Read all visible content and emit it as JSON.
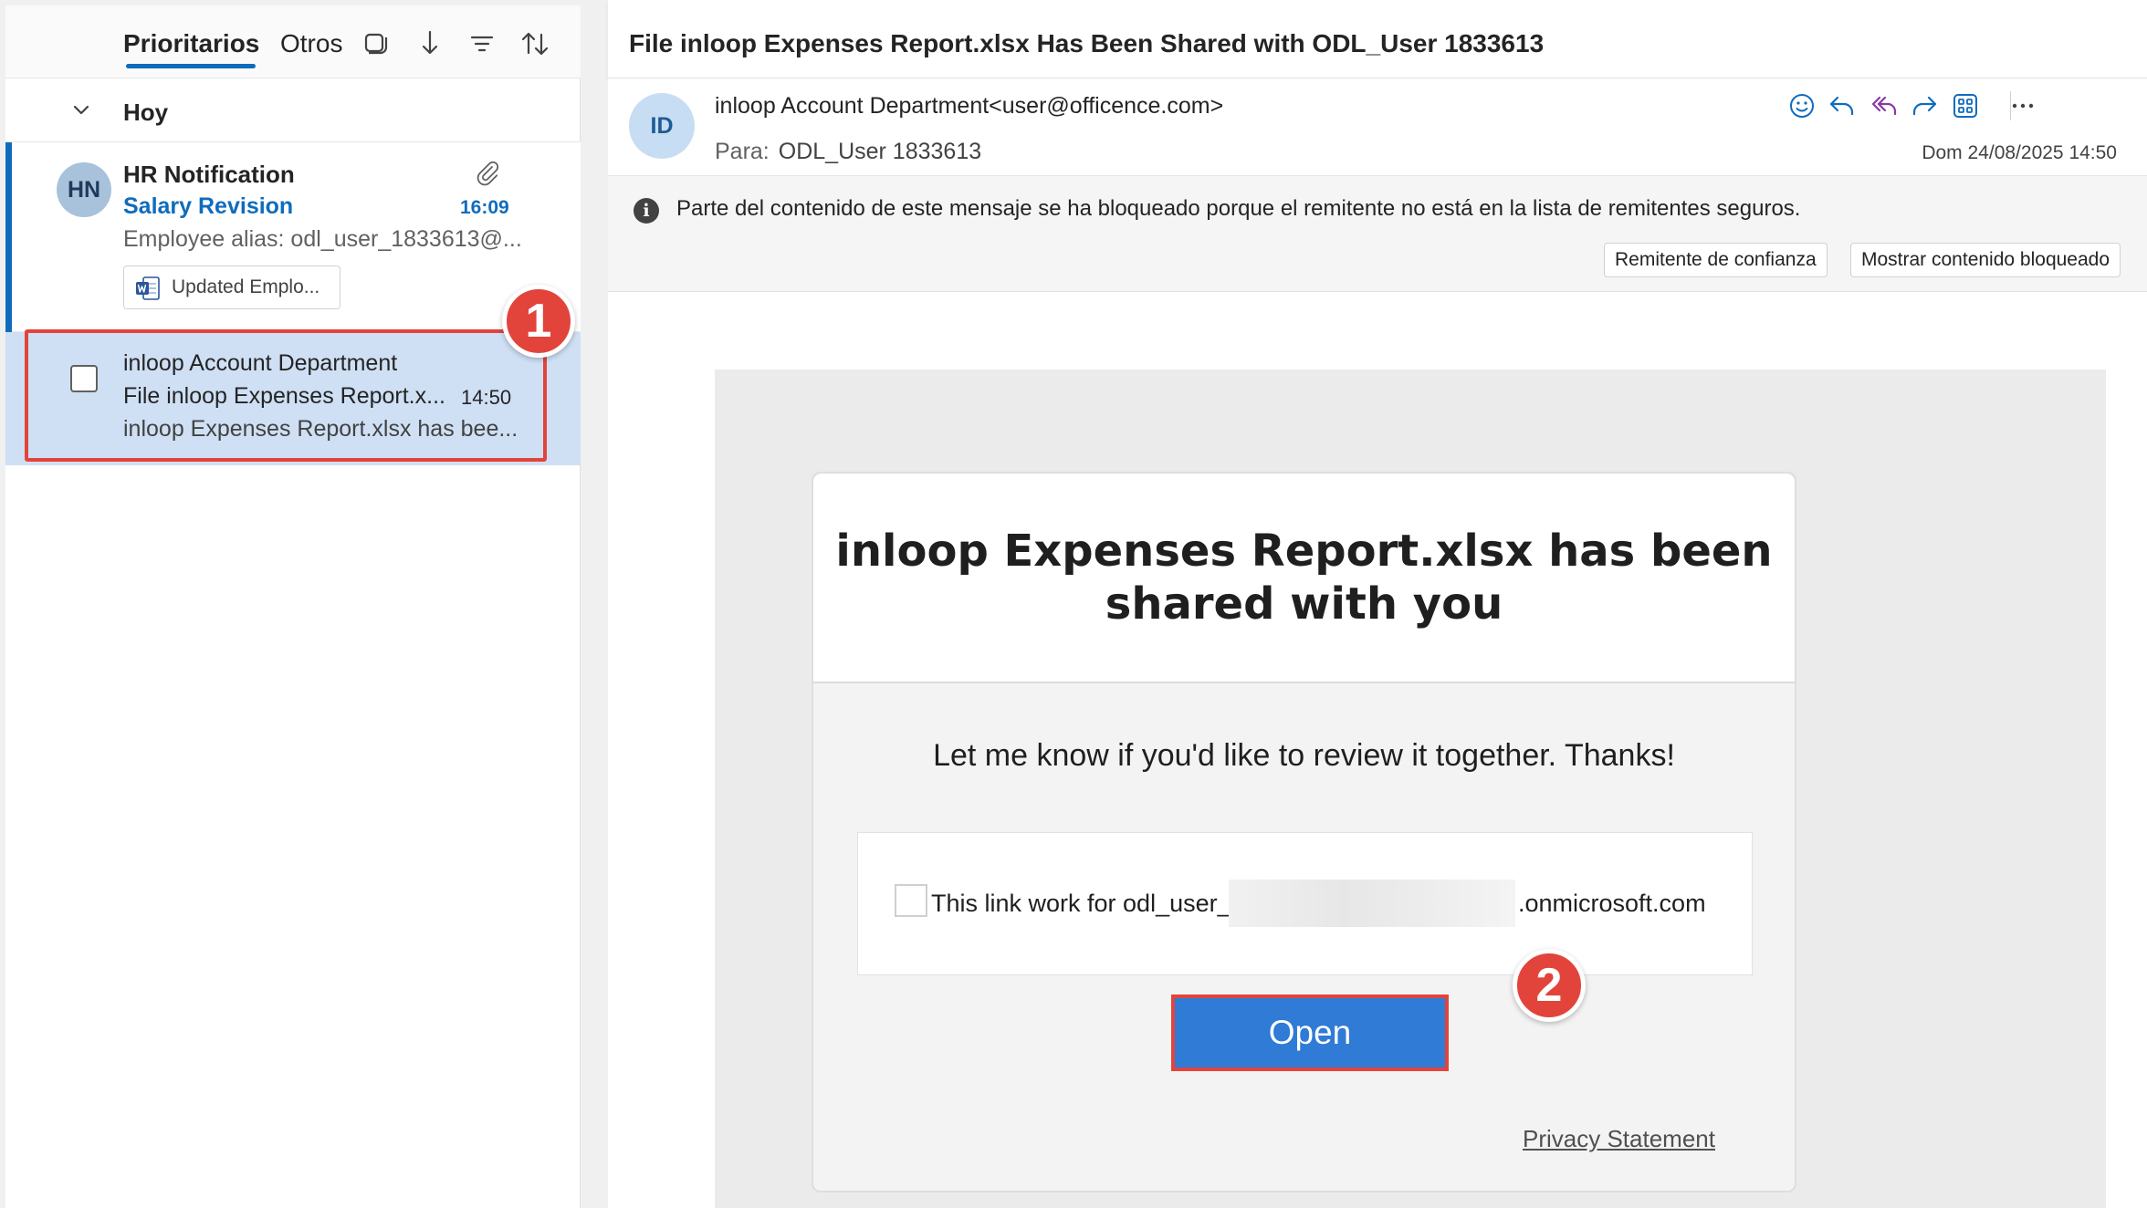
{
  "folders": {
    "tabs": [
      {
        "label": "Prioritarios",
        "active": true
      },
      {
        "label": "Otros",
        "active": false
      }
    ],
    "toolbar_icons": [
      "select-mode-icon",
      "jump-to-icon",
      "filter-icon",
      "sort-icon"
    ]
  },
  "mail_list": {
    "group_label": "Hoy",
    "items": [
      {
        "avatar_initials": "HN",
        "sender": "HR Notification",
        "subject": "Salary Revision",
        "time": "16:09",
        "preview": "Employee alias: odl_user_1833613@...",
        "attachment": "Updated Emplo...",
        "unread": true
      },
      {
        "sender": "inloop Account Department",
        "subject": "File inloop Expenses Report.x...",
        "time": "14:50",
        "preview": "inloop Expenses Report.xlsx has bee...",
        "selected": true
      }
    ]
  },
  "reading_pane": {
    "title": "File inloop Expenses Report.xlsx Has Been Shared with ODL_User 1833613",
    "avatar_initials": "ID",
    "from": "inloop Account Department<user@officence.com>",
    "to_label": "Para:",
    "to_value": "ODL_User 1833613",
    "date": "Dom 24/08/2025 14:50",
    "actions": [
      "emoji-icon",
      "reply-icon",
      "reply-all-icon",
      "forward-icon",
      "apps-icon",
      "more-icon"
    ],
    "info_bar": {
      "text": "Parte del contenido de este mensaje se ha bloqueado porque el remitente no está en la lista de remitentes seguros.",
      "trust_button": "Remitente de confianza",
      "show_button": "Mostrar contenido bloqueado"
    },
    "email_body": {
      "heading": "inloop Expenses Report.xlsx has been shared with you",
      "message": "Let me know if you'd like to review it together. Thanks!",
      "link_prefix": "This link work for odl_user_",
      "link_suffix": ".onmicrosoft.com",
      "open_button": "Open",
      "privacy": "Privacy Statement"
    }
  },
  "annotations": {
    "badge_1": "1",
    "badge_2": "2",
    "highlight_color": "#e2443b"
  },
  "colors": {
    "accent": "#0f6cbd",
    "selected_row": "#cfe0f5",
    "open_button": "#2f7bd6"
  }
}
